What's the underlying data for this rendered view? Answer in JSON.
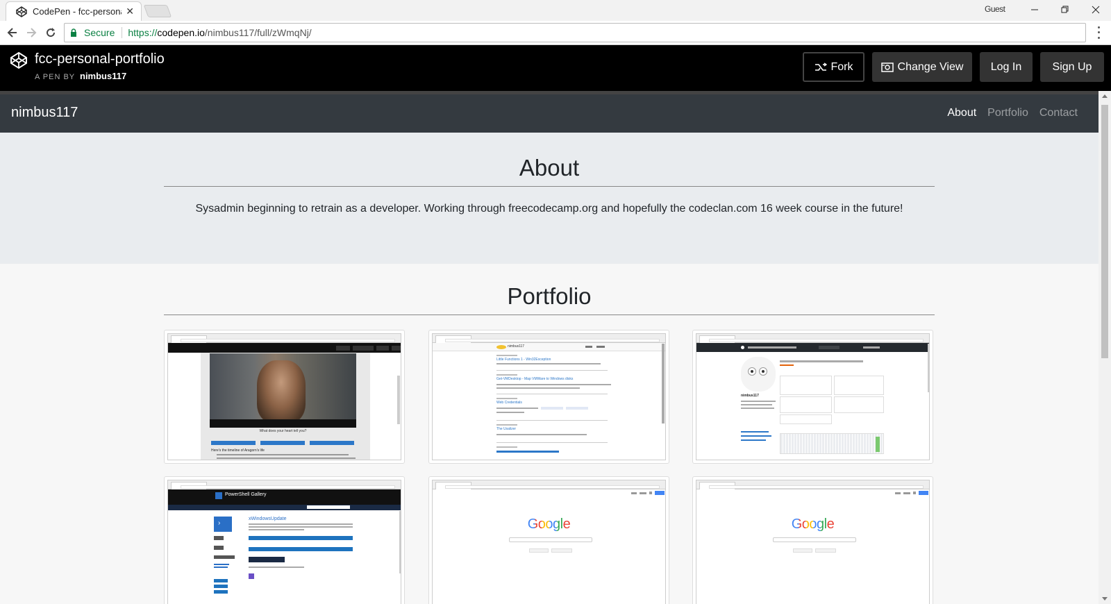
{
  "browser": {
    "tab_title": "CodePen - fcc-personal-portfolio",
    "tab_close": "✕",
    "profile": "Guest",
    "url_proto": "https://",
    "url_host": "codepen.io",
    "url_path": "/nimbus117/full/zWmqNj/",
    "secure_label": "Secure"
  },
  "codepen": {
    "pen_title": "fcc-personal-portfolio",
    "by_label": "A PEN BY",
    "author": "nimbus117",
    "buttons": {
      "fork": "Fork",
      "change_view": "Change View",
      "login": "Log In",
      "signup": "Sign Up"
    }
  },
  "site": {
    "brand": "nimbus117",
    "nav": [
      {
        "label": "About",
        "active": true
      },
      {
        "label": "Portfolio",
        "active": false
      },
      {
        "label": "Contact",
        "active": false
      }
    ],
    "about": {
      "title": "About",
      "text": "Sysadmin beginning to retrain as a developer. Working through freecodecamp.org and hopefully the codeclan.com 16 week course in the future!"
    },
    "portfolio": {
      "title": "Portfolio",
      "items": [
        {
          "thumb": "aragorn-tribute"
        },
        {
          "thumb": "nimbus117-blog"
        },
        {
          "thumb": "github-profile"
        },
        {
          "thumb": "powershell-gallery"
        },
        {
          "thumb": "google-search"
        },
        {
          "thumb": "google-search"
        }
      ]
    }
  },
  "thumb_text": {
    "tribute_caption": "What does your heart tell you?",
    "tribute_timeline": "Here's the timeline of Aragorn's life",
    "blog_brand": "nimbus117",
    "blog_posts": [
      "Little Functions 1 - Win32Exception",
      "Get-VMDesktop - Map VMWare to Windows disks",
      "Web Credentials",
      "The Usalizer"
    ],
    "gh_user": "nimbus117",
    "psg_title": "PowerShell Gallery",
    "psg_module": "xWindowsUpdate",
    "google_word": "Google"
  },
  "colors": {
    "codepen_bg": "#000000",
    "navbar_bg": "#343a40",
    "about_bg": "#e9ecef",
    "secure_green": "#0b8043"
  }
}
